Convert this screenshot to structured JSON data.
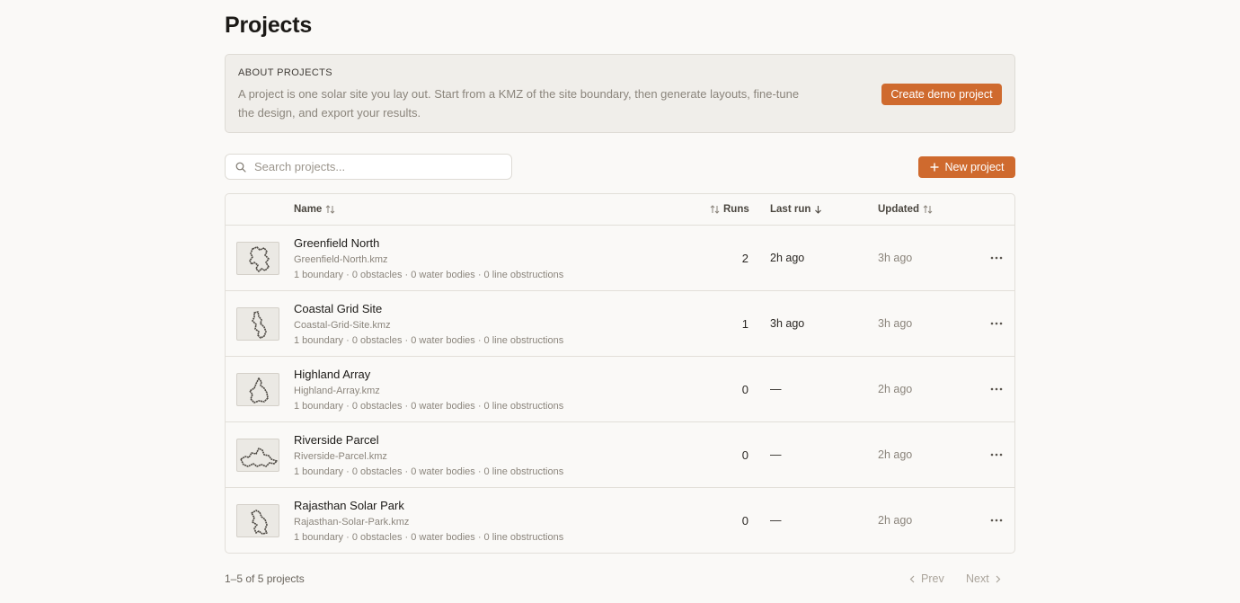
{
  "page": {
    "title": "Projects"
  },
  "about": {
    "heading": "ABOUT PROJECTS",
    "text": "A project is one solar site you lay out. Start from a KMZ of the site boundary, then generate layouts, fine-tune the design, and export your results.",
    "button": "Create demo project"
  },
  "toolbar": {
    "search_placeholder": "Search projects...",
    "new_button": "New project"
  },
  "table": {
    "headers": {
      "name": "Name",
      "runs": "Runs",
      "last_run": "Last run",
      "updated": "Updated"
    },
    "rows": [
      {
        "name": "Greenfield North",
        "file": "Greenfield-North.kmz",
        "meta": "1 boundary · 0 obstacles · 0 water bodies · 0 line obstructions",
        "runs": "2",
        "last_run": "2h ago",
        "updated": "3h ago"
      },
      {
        "name": "Coastal Grid Site",
        "file": "Coastal-Grid-Site.kmz",
        "meta": "1 boundary · 0 obstacles · 0 water bodies · 0 line obstructions",
        "runs": "1",
        "last_run": "3h ago",
        "updated": "3h ago"
      },
      {
        "name": "Highland Array",
        "file": "Highland-Array.kmz",
        "meta": "1 boundary · 0 obstacles · 0 water bodies · 0 line obstructions",
        "runs": "0",
        "last_run": "—",
        "updated": "2h ago"
      },
      {
        "name": "Riverside Parcel",
        "file": "Riverside-Parcel.kmz",
        "meta": "1 boundary · 0 obstacles · 0 water bodies · 0 line obstructions",
        "runs": "0",
        "last_run": "—",
        "updated": "2h ago"
      },
      {
        "name": "Rajasthan Solar Park",
        "file": "Rajasthan-Solar-Park.kmz",
        "meta": "1 boundary · 0 obstacles · 0 water bodies · 0 line obstructions",
        "runs": "0",
        "last_run": "—",
        "updated": "2h ago"
      }
    ]
  },
  "footer": {
    "count": "1–5 of 5 projects",
    "prev": "Prev",
    "next": "Next"
  },
  "colors": {
    "accent": "#cf6a2e",
    "background": "#faf9f7"
  }
}
